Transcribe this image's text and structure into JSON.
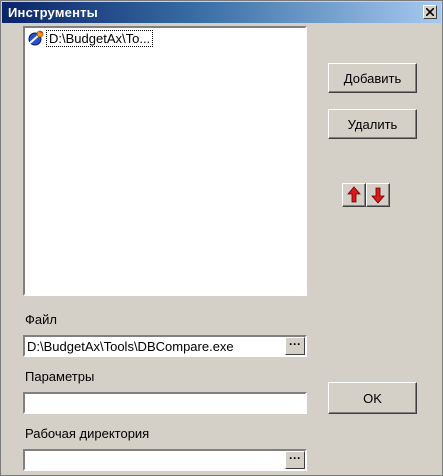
{
  "window": {
    "title": "Инструменты",
    "close_icon": "close-icon"
  },
  "tools_list": {
    "items": [
      {
        "label": "D:\\BudgetAx\\To...",
        "icon": "tool-app-icon",
        "selected": true
      }
    ]
  },
  "buttons": {
    "add_label": "Добавить",
    "delete_label": "Удалить",
    "ok_label": "OK",
    "move_up_icon": "arrow-up-icon",
    "move_down_icon": "arrow-down-icon",
    "browse_label": "···"
  },
  "fields": {
    "file_label": "Файл",
    "file_value": "D:\\BudgetAx\\Tools\\DBCompare.exe",
    "params_label": "Параметры",
    "params_value": "",
    "workdir_label": "Рабочая директория",
    "workdir_value": ""
  },
  "colors": {
    "titlebar_start": "#0a246a",
    "titlebar_end": "#a6caf0",
    "dialog_bg": "#d4d0c8",
    "arrow_red": "#e01818"
  }
}
